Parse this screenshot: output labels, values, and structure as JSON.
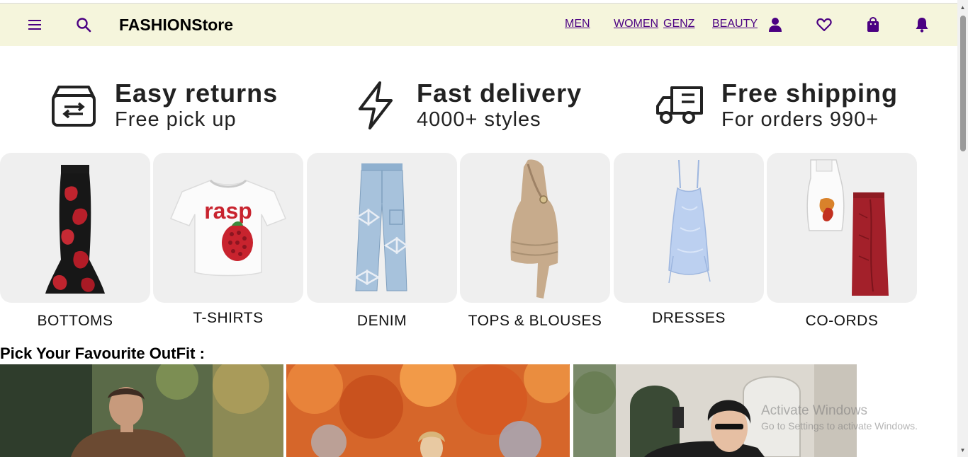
{
  "header": {
    "brand": "FASHIONStore",
    "links": [
      "MEN",
      "WOMEN",
      "GENZ",
      "BEAUTY"
    ],
    "icons": [
      "menu-icon",
      "search-icon",
      "user-icon",
      "heart-icon",
      "shopping-bag-icon",
      "bell-icon"
    ],
    "colors": {
      "background": "#f5f5dc",
      "icon": "#4b0082"
    }
  },
  "benefits": [
    {
      "title": "Easy returns",
      "subtitle": "Free pick up",
      "icon": "return-box-icon"
    },
    {
      "title": "Fast delivery",
      "subtitle": "4000+ styles",
      "icon": "lightning-icon"
    },
    {
      "title": "Free shipping",
      "subtitle": "For orders 990+",
      "icon": "delivery-truck-icon"
    }
  ],
  "categories": [
    {
      "label": "BOTTOMS",
      "image": "floral-maxi-skirt"
    },
    {
      "label": "T-SHIRTS",
      "image": "rasp-graphic-tee",
      "print": "rasp"
    },
    {
      "label": "DENIM",
      "image": "bow-cargo-jeans"
    },
    {
      "label": "TOPS & BLOUSES",
      "image": "halter-top"
    },
    {
      "label": "DRESSES",
      "image": "blue-slip-dress"
    },
    {
      "label": "CO-ORDS",
      "image": "top-and-skirt-set"
    }
  ],
  "section": {
    "title": "Pick Your Favourite OutFit :"
  },
  "outfits": [
    "autumn-man-photo",
    "autumn-leaves-photo",
    "city-woman-photo"
  ],
  "overlay": {
    "line1": "Activate Windows",
    "line2": "Go to Settings to activate Windows."
  }
}
